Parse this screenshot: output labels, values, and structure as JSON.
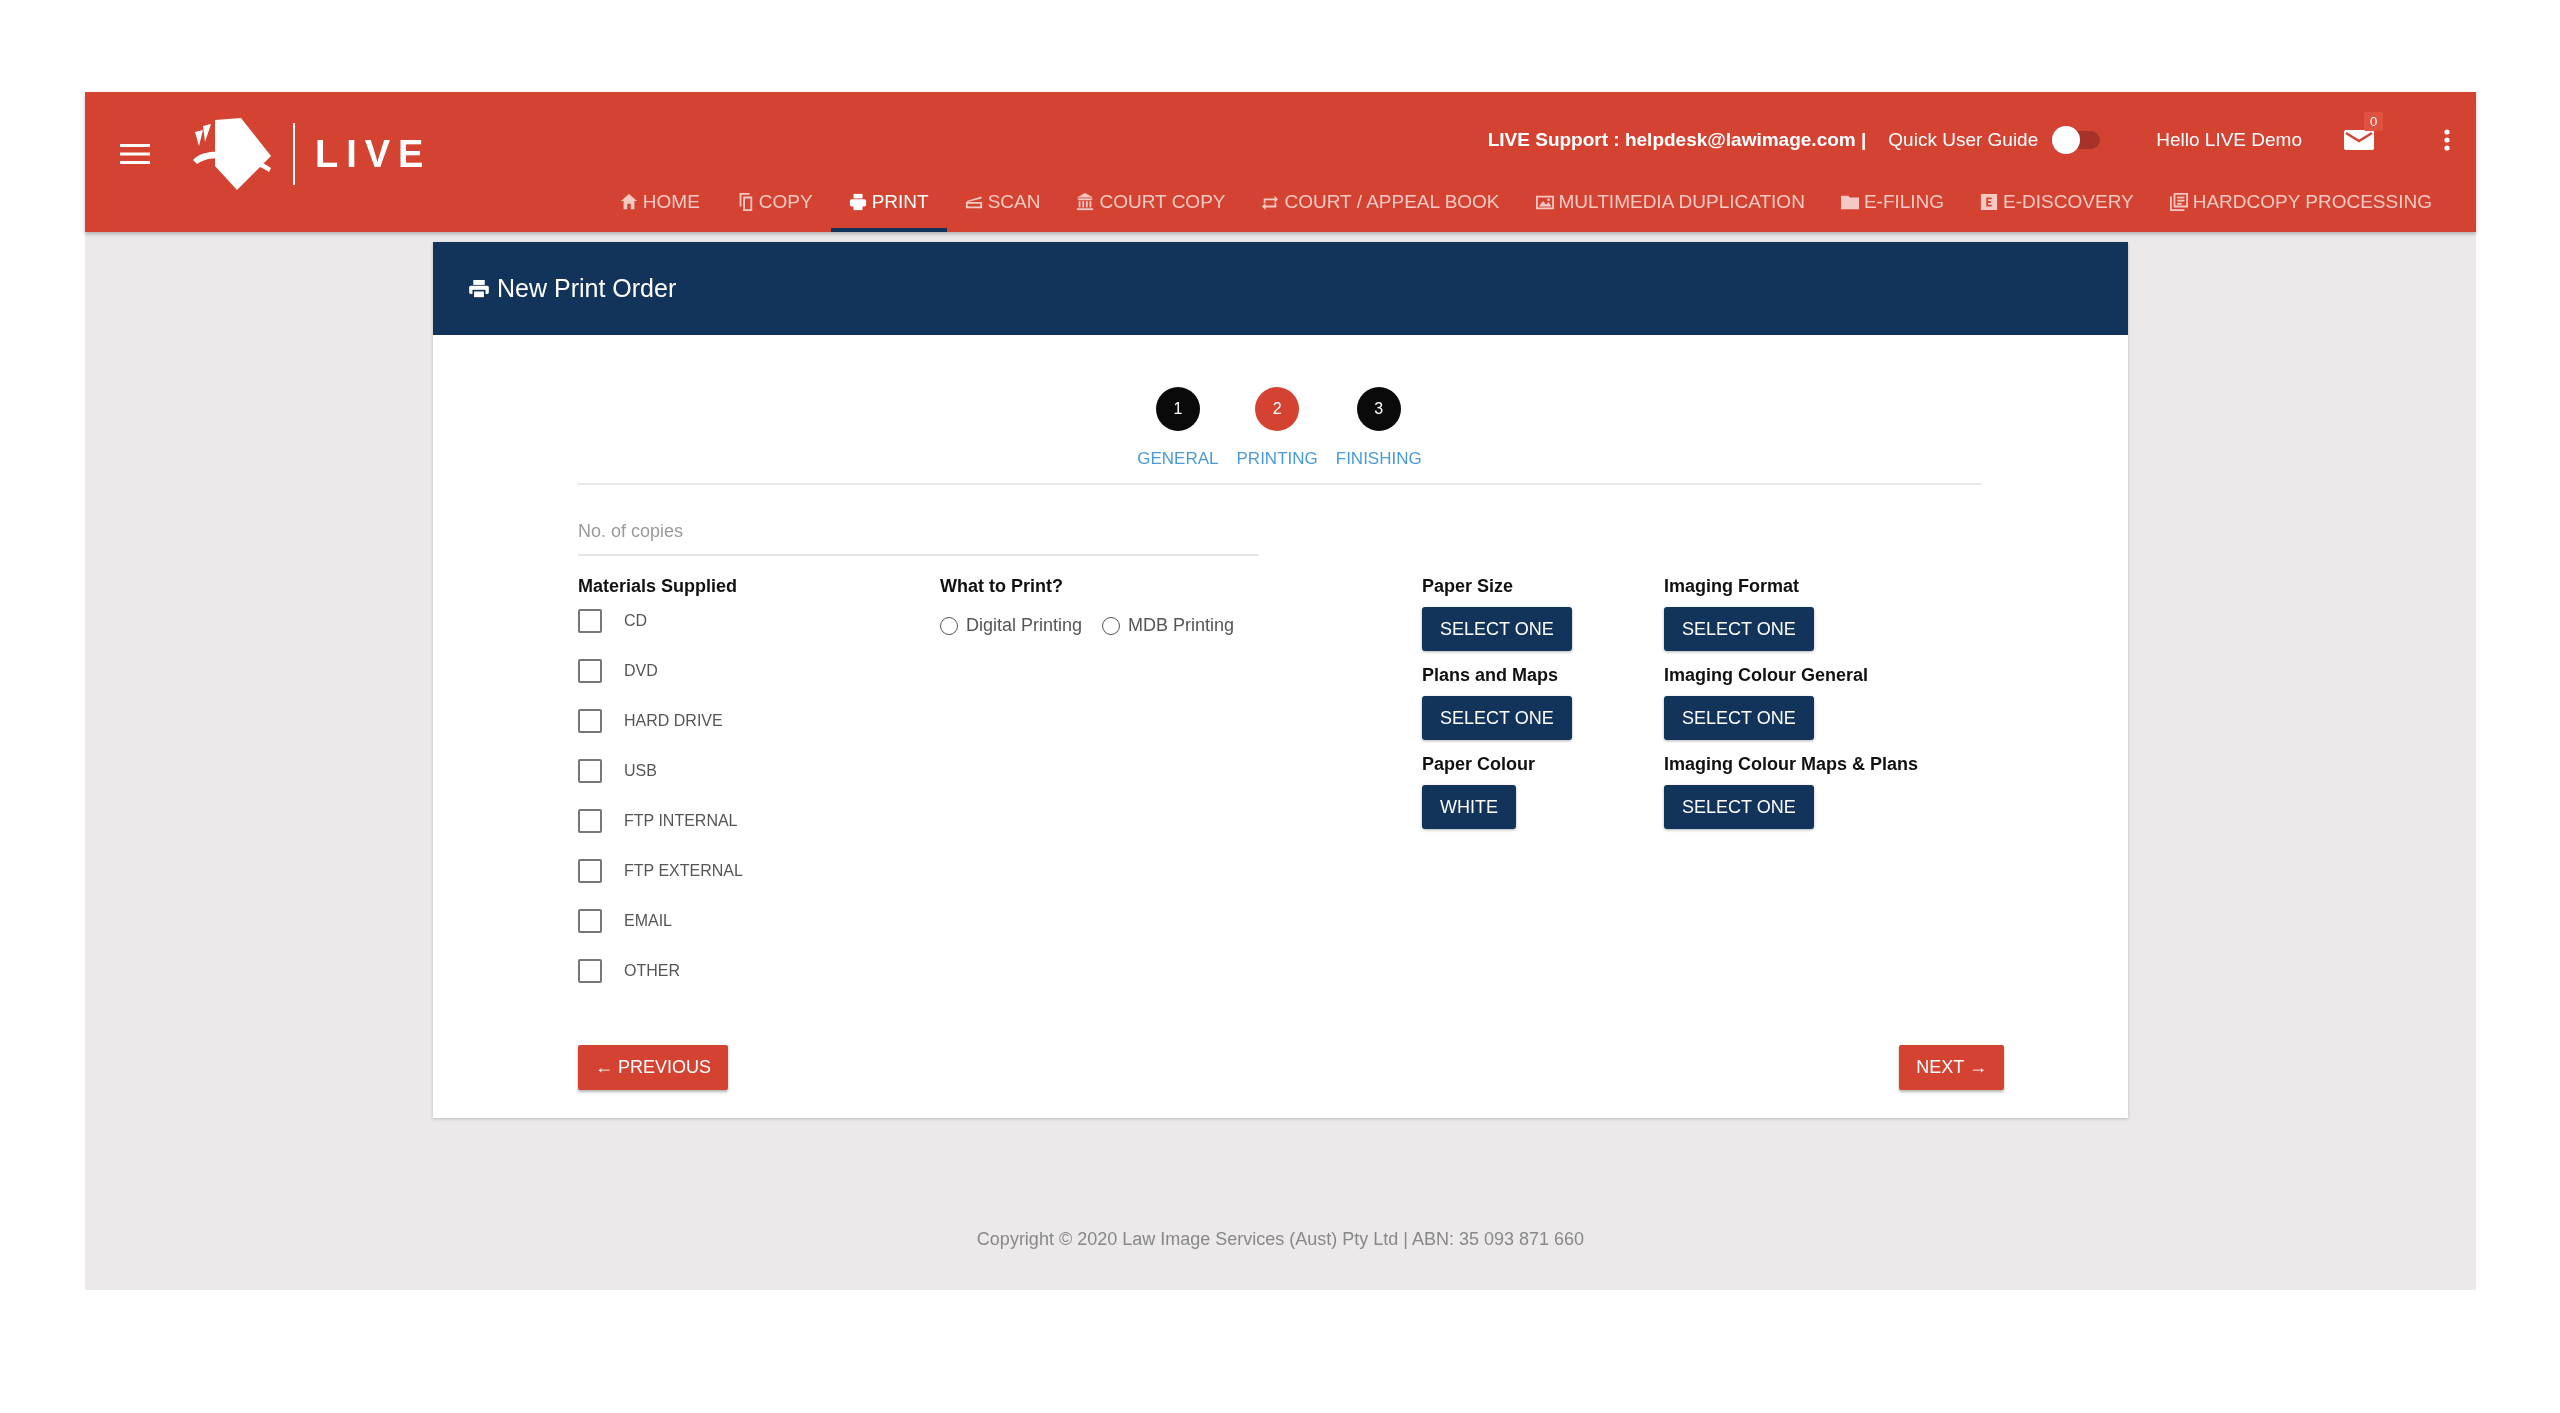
{
  "header": {
    "logo_text": "LIVE",
    "support": "LIVE Support : helpdesk@lawimage.com |",
    "guide": {
      "label": "Quick User Guide",
      "on": false
    },
    "greeting": "Hello LIVE Demo",
    "mail_badge": "0"
  },
  "nav": [
    {
      "label": "HOME",
      "kind": "home",
      "selected": false
    },
    {
      "label": "COPY",
      "kind": "copy",
      "selected": false
    },
    {
      "label": "PRINT",
      "kind": "print",
      "selected": true
    },
    {
      "label": "SCAN",
      "kind": "scan",
      "selected": false
    },
    {
      "label": "COURT COPY",
      "kind": "court",
      "selected": false
    },
    {
      "label": "COURT / APPEAL BOOK",
      "kind": "repeat",
      "selected": false
    },
    {
      "label": "MULTIMEDIA DUPLICATION",
      "kind": "image",
      "selected": false
    },
    {
      "label": "E-FILING",
      "kind": "folder",
      "selected": false
    },
    {
      "label": "E-DISCOVERY",
      "kind": "ebox",
      "selected": false
    },
    {
      "label": "HARDCOPY PROCESSING",
      "kind": "doc",
      "selected": false
    }
  ],
  "card": {
    "title": "New Print Order"
  },
  "steps": [
    {
      "number": "1",
      "label": "GENERAL",
      "selected": false
    },
    {
      "number": "2",
      "label": "PRINTING",
      "selected": true
    },
    {
      "number": "3",
      "label": "FINISHING",
      "selected": false
    }
  ],
  "copies": {
    "placeholder": "No. of copies"
  },
  "materials": {
    "heading": "Materials Supplied",
    "items": [
      {
        "label": "CD",
        "checked": false
      },
      {
        "label": "DVD",
        "checked": false
      },
      {
        "label": "HARD DRIVE",
        "checked": false
      },
      {
        "label": "USB",
        "checked": false
      },
      {
        "label": "FTP INTERNAL",
        "checked": false
      },
      {
        "label": "FTP EXTERNAL",
        "checked": false
      },
      {
        "label": "EMAIL",
        "checked": false
      },
      {
        "label": "OTHER",
        "checked": false
      }
    ]
  },
  "what_to_print": {
    "heading": "What to Print?",
    "options": [
      {
        "label": "Digital Printing",
        "selected": false
      },
      {
        "label": "MDB Printing",
        "selected": false
      }
    ]
  },
  "select_columns": [
    [
      {
        "label": "Paper Size",
        "value": "SELECT ONE"
      },
      {
        "label": "Plans and Maps",
        "value": "SELECT ONE"
      },
      {
        "label": "Paper Colour",
        "value": "WHITE"
      }
    ],
    [
      {
        "label": "Imaging Format",
        "value": "SELECT ONE"
      },
      {
        "label": "Imaging Colour General",
        "value": "SELECT ONE"
      },
      {
        "label": "Imaging Colour Maps & Plans",
        "value": "SELECT ONE"
      }
    ]
  ],
  "buttons": {
    "previous": "← PREVIOUS",
    "next": "NEXT →"
  },
  "footer": "Copyright © 2020 Law Image Services (Aust) Pty Ltd | ABN: 35 093 871 660"
}
